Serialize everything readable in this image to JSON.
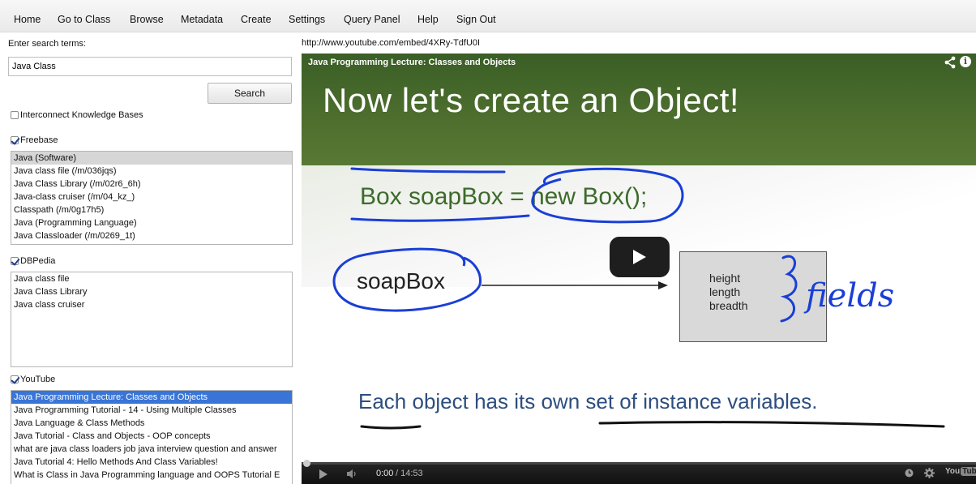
{
  "menu": {
    "items": [
      "Home",
      "Go to Class",
      "Browse",
      "Metadata",
      "Create",
      "Settings",
      "Query Panel",
      "Help",
      "Sign Out"
    ]
  },
  "search": {
    "label": "Enter search terms:",
    "value": "Java Class",
    "button": "Search"
  },
  "interconnect": {
    "label": "Interconnect Knowledge Bases",
    "checked": false
  },
  "freebase": {
    "label": "Freebase",
    "checked": true,
    "items": [
      "Java (Software)",
      "Java class file (/m/036jqs)",
      "Java Class Library (/m/02r6_6h)",
      "Java-class cruiser (/m/04_kz_)",
      "Classpath (/m/0g17h5)",
      "Java (Programming Language)",
      "Java Classloader (/m/0269_1t)"
    ],
    "selected": 0
  },
  "dbpedia": {
    "label": "DBPedia",
    "checked": true,
    "items": [
      "Java class file",
      "Java Class Library",
      "Java class cruiser"
    ]
  },
  "youtube": {
    "label": "YouTube",
    "checked": true,
    "items": [
      "Java Programming Lecture: Classes and Objects",
      "Java Programming Tutorial - 14 - Using Multiple Classes",
      "Java Language & Class Methods",
      "Java Tutorial - Class and Objects - OOP concepts",
      "what are java class loaders job java interview question and answer",
      "Java Tutorial 4: Hello Methods And Class Variables!",
      "What is Class in Java Programming language and OOPS Tutorial E"
    ],
    "selected": 0
  },
  "video": {
    "url": "http://www.youtube.com/embed/4XRy-TdfU0I",
    "title": "Java Programming Lecture: Classes and Objects",
    "slide": {
      "heading": "Now let's create an Object!",
      "code": "Box soapBox = new Box();",
      "object_label": "soapBox",
      "fields": [
        "height",
        "length",
        "breadth"
      ],
      "handwritten_note": "3 fields",
      "footer": "Each object has its own set of instance variables."
    },
    "time_current": "0:00",
    "time_total": "/ 14:53",
    "logo": "You",
    "logo_tube": "Tube",
    "colors": {
      "slide_green": "#4e6f2e",
      "ink_blue": "#1a3fd6",
      "selected_blue": "#3875d7"
    }
  }
}
